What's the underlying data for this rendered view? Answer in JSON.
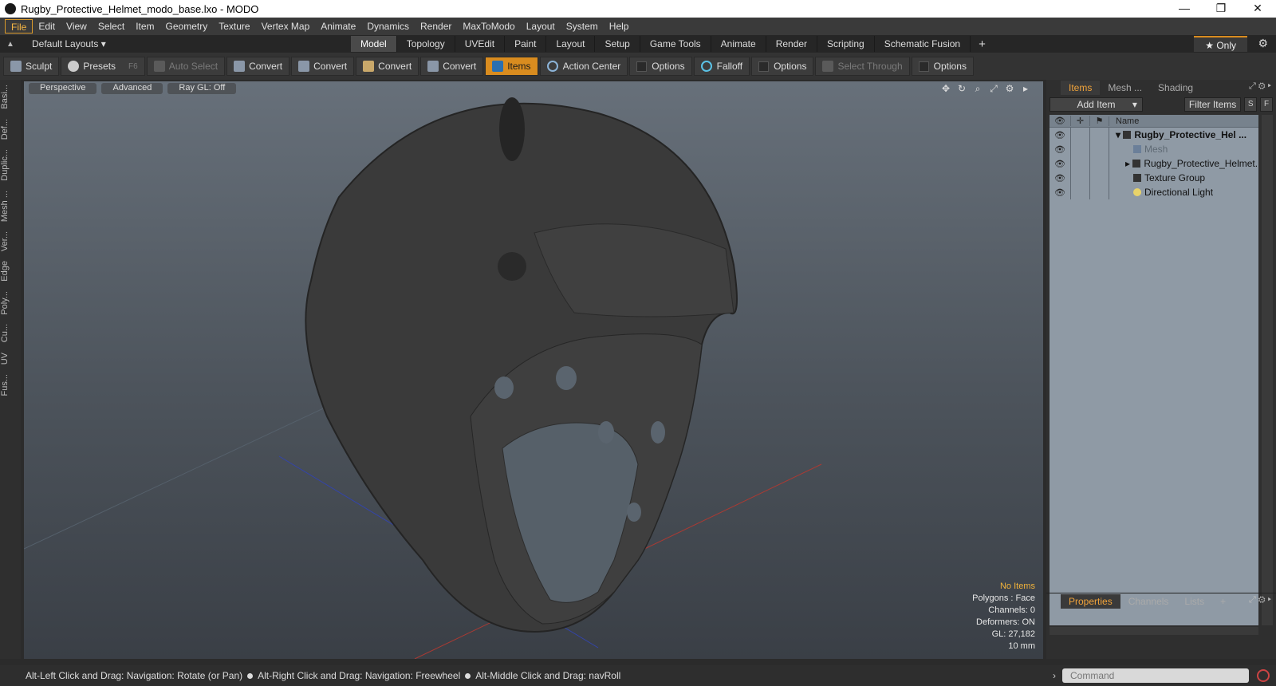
{
  "window": {
    "title": "Rugby_Protective_Helmet_modo_base.lxo - MODO",
    "minimize": "—",
    "maximize": "❐",
    "close": "✕"
  },
  "menu": [
    "File",
    "Edit",
    "View",
    "Select",
    "Item",
    "Geometry",
    "Texture",
    "Vertex Map",
    "Animate",
    "Dynamics",
    "Render",
    "MaxToModo",
    "Layout",
    "System",
    "Help"
  ],
  "layouts": {
    "label": "Default Layouts ▾",
    "tabs": [
      "Model",
      "Topology",
      "UVEdit",
      "Paint",
      "Layout",
      "Setup",
      "Game Tools",
      "Animate",
      "Render",
      "Scripting",
      "Schematic Fusion"
    ],
    "active_tab": "Model",
    "plus": "+",
    "only": "★ Only"
  },
  "toolbar": {
    "sculpt": "Sculpt",
    "presets": "Presets",
    "presets_key": "F6",
    "auto_select": "Auto Select",
    "convert1": "Convert",
    "convert2": "Convert",
    "convert3": "Convert",
    "convert4": "Convert",
    "items": "Items",
    "action_center": "Action Center",
    "options1": "Options",
    "falloff": "Falloff",
    "options2": "Options",
    "select_through": "Select Through",
    "options3": "Options"
  },
  "left_tabs": [
    "Basi...",
    "Def...",
    "Duplic...",
    "Mesh ...",
    "Ver...",
    "Edge",
    "Poly...",
    "Cu...",
    "UV",
    "Fus..."
  ],
  "viewport": {
    "view_mode": "Perspective",
    "shading": "Advanced",
    "raygl": "Ray GL: Off",
    "info": {
      "no_items": "No Items",
      "polygons": "Polygons : Face",
      "channels": "Channels: 0",
      "deformers": "Deformers: ON",
      "gl": "GL: 27,182",
      "unit": "10 mm"
    }
  },
  "items_panel": {
    "tabs": [
      "Items",
      "Mesh ...",
      "Shading"
    ],
    "add_item": "Add Item",
    "filter_items": "Filter Items",
    "s_btn": "S",
    "f_btn": "F",
    "col_name": "Name",
    "rows": [
      {
        "name": "Rugby_Protective_Hel ...",
        "kind": "root"
      },
      {
        "name": "Mesh",
        "kind": "mesh"
      },
      {
        "name": "Rugby_Protective_Helmet...",
        "kind": "group"
      },
      {
        "name": "Texture Group",
        "kind": "texture"
      },
      {
        "name": "Directional Light",
        "kind": "light"
      }
    ]
  },
  "properties_panel": {
    "tabs": [
      "Properties",
      "Channels",
      "Lists"
    ],
    "plus": "+"
  },
  "status": {
    "hint1": "Alt-Left Click and Drag: Navigation: Rotate (or Pan)",
    "hint2": "Alt-Right Click and Drag: Navigation: Freewheel",
    "hint3": "Alt-Middle Click and Drag: navRoll"
  },
  "command": {
    "placeholder": "Command"
  },
  "colors": {
    "accent": "#d98c1f",
    "viewport_top": "#67707a",
    "viewport_bottom": "#3a3f46",
    "list_bg": "#8f9aa5"
  }
}
